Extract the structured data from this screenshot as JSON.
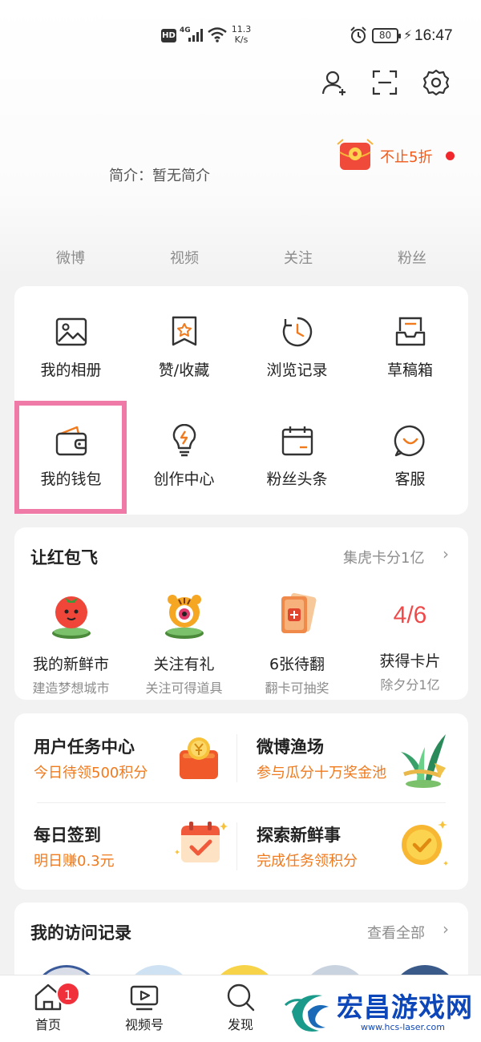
{
  "status_bar": {
    "hd": "HD",
    "network": "4G",
    "speed_top": "11.3",
    "speed_bottom": "K/s",
    "battery": "80",
    "time": "16:47"
  },
  "header": {
    "icons": [
      "add-user-icon",
      "scan-icon",
      "gear-icon"
    ]
  },
  "profile": {
    "bio": "简介：暂无简介",
    "promo_text": "不止5折"
  },
  "stats": [
    "微博",
    "视频",
    "关注",
    "粉丝"
  ],
  "tools": [
    {
      "label": "我的相册",
      "icon": "album-icon"
    },
    {
      "label": "赞/收藏",
      "icon": "favorites-icon"
    },
    {
      "label": "浏览记录",
      "icon": "history-icon"
    },
    {
      "label": "草稿箱",
      "icon": "drafts-icon"
    },
    {
      "label": "我的钱包",
      "icon": "wallet-icon"
    },
    {
      "label": "创作中心",
      "icon": "lightbulb-icon"
    },
    {
      "label": "粉丝头条",
      "icon": "calendar-icon"
    },
    {
      "label": "客服",
      "icon": "customer-service-icon"
    }
  ],
  "event_section": {
    "title": "让红包飞",
    "more": "集虎卡分1亿",
    "items": [
      {
        "title": "我的新鲜市",
        "subtitle": "建造梦想城市"
      },
      {
        "title": "关注有礼",
        "subtitle": "关注可得道具"
      },
      {
        "title": "6张待翻",
        "subtitle": "翻卡可抽奖"
      },
      {
        "title": "获得卡片",
        "subtitle": "除夕分1亿",
        "counter": "4/6"
      }
    ]
  },
  "tasks": [
    {
      "title": "用户任务中心",
      "subtitle": "今日待领500积分"
    },
    {
      "title": "微博渔场",
      "subtitle": "参与瓜分十万奖金池"
    },
    {
      "title": "每日签到",
      "subtitle": "明日赚0.3元"
    },
    {
      "title": "探索新鲜事",
      "subtitle": "完成任务领积分"
    }
  ],
  "visit_section": {
    "title": "我的访问记录",
    "more": "查看全部"
  },
  "bottom_nav": {
    "items": [
      {
        "label": "首页",
        "badge": "1"
      },
      {
        "label": "视频号"
      },
      {
        "label": "发现"
      }
    ]
  },
  "watermark": {
    "title": "宏昌游戏网",
    "url": "www.hcs-laser.com"
  },
  "colors": {
    "accent_orange": "#f07a1e",
    "highlight_pink": "#f07aa7",
    "badge_red": "#f0313b",
    "counter_red": "#ef4a4a"
  }
}
